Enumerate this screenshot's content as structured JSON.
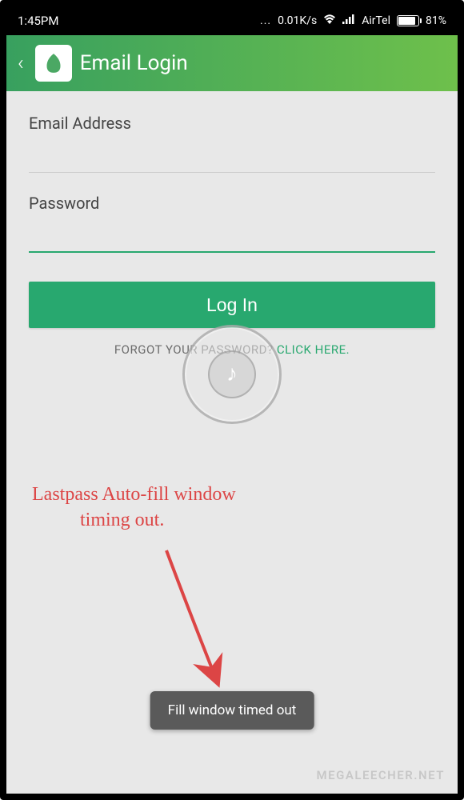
{
  "status": {
    "time": "1:45PM",
    "dots": "...",
    "speed": "0.01K/s",
    "carrier": "AirTel",
    "battery_pct": "81%"
  },
  "header": {
    "title": "Email Login"
  },
  "form": {
    "email_label": "Email Address",
    "password_label": "Password",
    "login_label": "Log In",
    "forgot_prefix": "FORGOT YOUR PASSWORD? ",
    "forgot_link": "CLICK HERE."
  },
  "annotation": {
    "line1": "Lastpass Auto-fill window",
    "line2": "timing out."
  },
  "toast": {
    "message": "Fill window timed out"
  },
  "watermark": "MEGALEECHER.NET"
}
